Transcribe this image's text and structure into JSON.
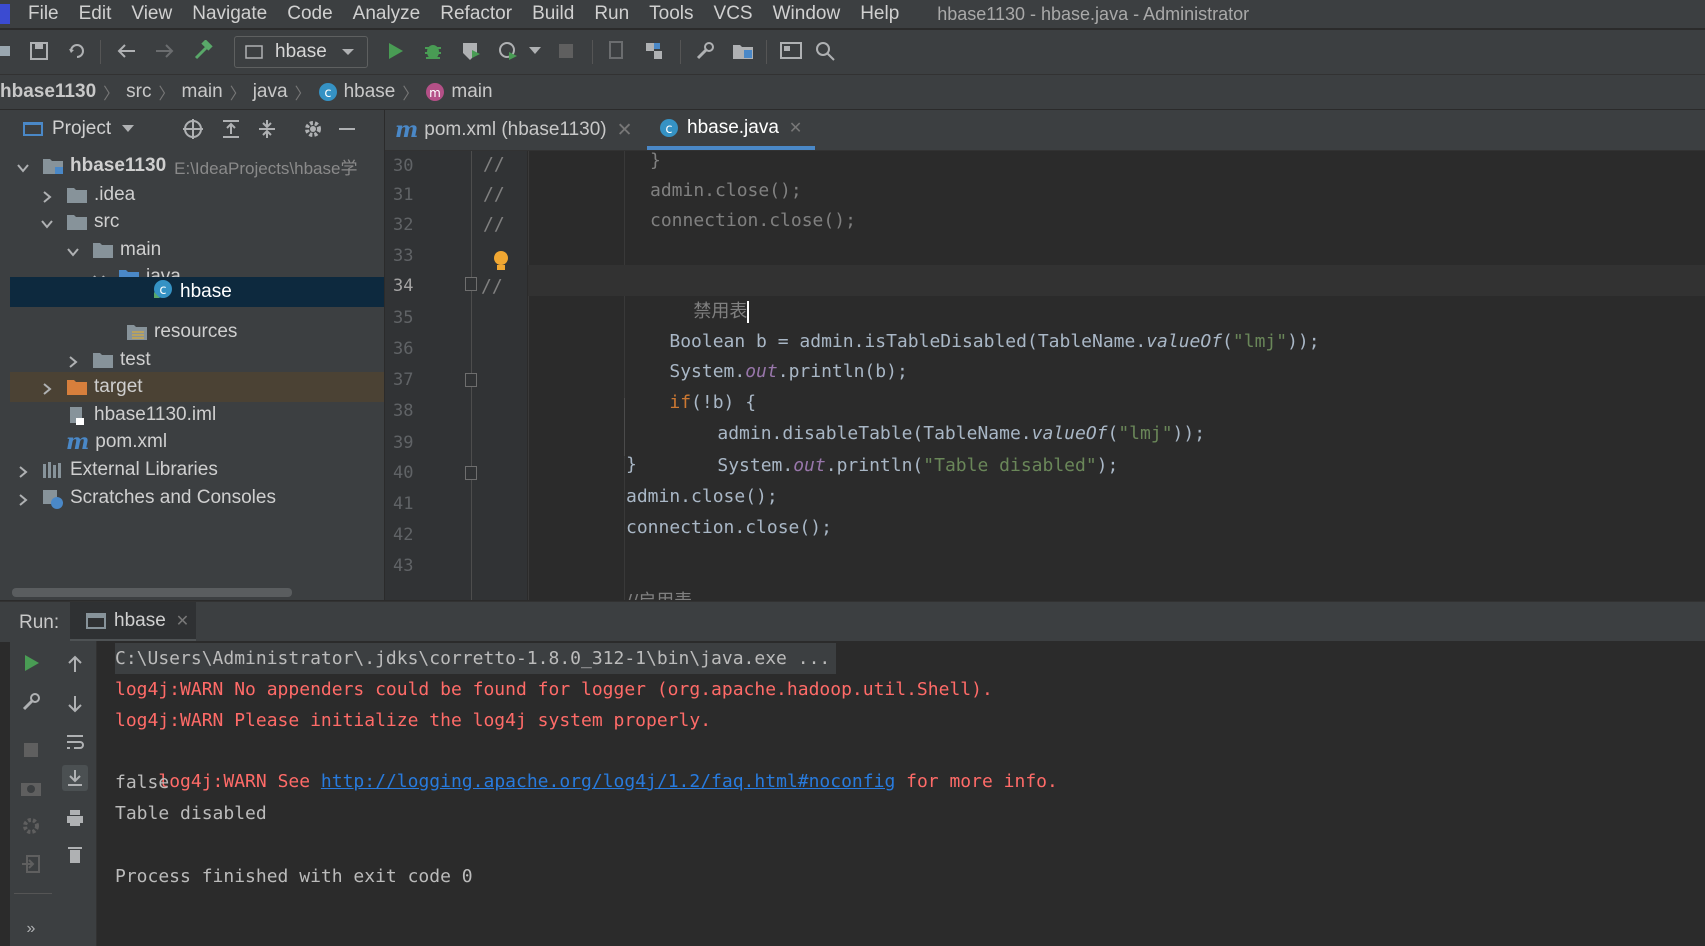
{
  "menu": {
    "items": [
      "File",
      "Edit",
      "View",
      "Navigate",
      "Code",
      "Analyze",
      "Refactor",
      "Build",
      "Run",
      "Tools",
      "VCS",
      "Window",
      "Help"
    ],
    "window_title": "hbase1130 - hbase.java - Administrator"
  },
  "toolbar": {
    "run_config": "hbase"
  },
  "breadcrumb": [
    "hbase1130",
    "src",
    "main",
    "java",
    "hbase",
    "main"
  ],
  "project": {
    "title": "Project",
    "root_name": "hbase1130",
    "root_path": "E:\\IdeaProjects\\hbase学",
    "tree": [
      ".idea",
      "src",
      "main",
      "java",
      "hbase",
      "resources",
      "test",
      "target",
      "hbase1130.iml",
      "pom.xml",
      "External Libraries",
      "Scratches and Consoles"
    ]
  },
  "editor": {
    "tabs": [
      "pom.xml (hbase1130)",
      "hbase.java"
    ],
    "active_tab": "hbase.java",
    "line_numbers": [
      "30",
      "31",
      "32",
      "33",
      "34",
      "35",
      "36",
      "37",
      "38",
      "39",
      "40",
      "41",
      "42",
      "43"
    ],
    "comment_markers": [
      "//",
      "//",
      "//",
      "//"
    ],
    "code": {
      "l30": "}",
      "l31": "admin.close();",
      "l32": "connection.close();",
      "l34": "禁用表",
      "l35_a": "Boolean b = admin.isTableDisabled(TableName.",
      "l35_b": "valueOf",
      "l35_c": "(",
      "l35_str": "\"lmj\"",
      "l35_d": "));",
      "l36_a": "System.",
      "l36_fld": "out",
      "l36_b": ".println(b);",
      "l37_kw": "if",
      "l37_b": "(!b) {",
      "l38_a": "admin.disableTable(TableName.",
      "l38_b": "valueOf",
      "l38_c": "(",
      "l38_str": "\"lmj\"",
      "l38_d": "));",
      "l39_a": "System.",
      "l39_fld": "out",
      "l39_b": ".println(",
      "l39_str": "\"Table disabled\"",
      "l39_c": ");",
      "l40": "}",
      "l41": "admin.close();",
      "l42": "connection.close();",
      "l44": "//启用表"
    }
  },
  "run": {
    "label": "Run:",
    "tab": "hbase",
    "console": {
      "cmd": "C:\\Users\\Administrator\\.jdks\\corretto-1.8.0_312-1\\bin\\java.exe ...",
      "warn1": "log4j:WARN No appenders could be found for logger (org.apache.hadoop.util.Shell).",
      "warn2": "log4j:WARN Please initialize the log4j system properly.",
      "warn3_pre": "log4j:WARN See ",
      "warn3_link": "http://logging.apache.org/log4j/1.2/faq.html#noconfig",
      "warn3_post": " for more info.",
      "out1": "false",
      "out2": "Table disabled",
      "exit": "Process finished with exit code 0"
    }
  },
  "colors": {
    "keyword": "#cc7832",
    "string": "#6a8759",
    "field": "#9876aa",
    "warning": "#ff6b68",
    "link": "#287bde",
    "selection": "#0d293e"
  }
}
